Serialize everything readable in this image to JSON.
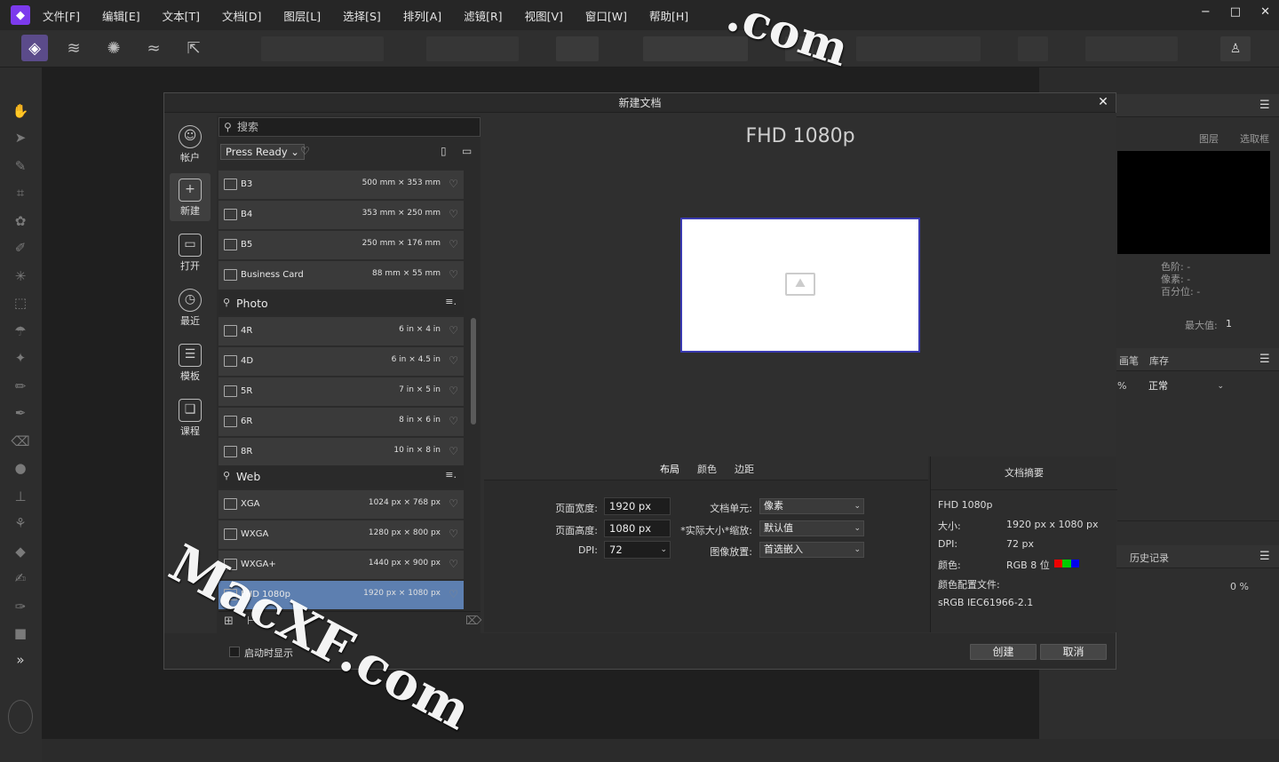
{
  "menu": {
    "items": [
      "文件[F]",
      "编辑[E]",
      "文本[T]",
      "文档[D]",
      "图层[L]",
      "选择[S]",
      "排列[A]",
      "滤镜[R]",
      "视图[V]",
      "窗口[W]",
      "帮助[H]"
    ],
    "window_controls": [
      "−",
      "□",
      "✕"
    ]
  },
  "dialog": {
    "title": "新建文档",
    "close": "✕",
    "nav": [
      {
        "label": "帐户",
        "icon": "account-icon"
      },
      {
        "label": "新建",
        "icon": "new-document-icon"
      },
      {
        "label": "打开",
        "icon": "open-folder-icon"
      },
      {
        "label": "最近",
        "icon": "recent-clock-icon"
      },
      {
        "label": "模板",
        "icon": "template-icon"
      },
      {
        "label": "课程",
        "icon": "tutorials-book-icon"
      }
    ],
    "search_placeholder": "搜索",
    "category": "Press Ready",
    "press_items": [
      {
        "name": "B3",
        "size": "500 mm × 353 mm"
      },
      {
        "name": "B4",
        "size": "353 mm × 250 mm"
      },
      {
        "name": "B5",
        "size": "250 mm × 176 mm"
      },
      {
        "name": "Business Card",
        "size": "88 mm × 55 mm"
      }
    ],
    "photo_group": "Photo",
    "photo_items": [
      {
        "name": "4R",
        "size": "6 in × 4 in"
      },
      {
        "name": "4D",
        "size": "6 in × 4.5 in"
      },
      {
        "name": "5R",
        "size": "7 in × 5 in"
      },
      {
        "name": "6R",
        "size": "8 in × 6 in"
      },
      {
        "name": "8R",
        "size": "10 in × 8 in"
      }
    ],
    "web_group": "Web",
    "web_items": [
      {
        "name": "XGA",
        "size": "1024 px × 768 px"
      },
      {
        "name": "WXGA",
        "size": "1280 px × 800 px"
      },
      {
        "name": "WXGA+",
        "size": "1440 px × 900 px"
      },
      {
        "name": "FHD 1080p",
        "size": "1920 px × 1080 px"
      }
    ],
    "preview_title": "FHD 1080p",
    "tabs": [
      "布局",
      "颜色",
      "边距"
    ],
    "layout": {
      "width_label": "页面宽度:",
      "width_value": "1920 px",
      "height_label": "页面高度:",
      "height_value": "1080 px",
      "dpi_label": "DPI:",
      "dpi_value": "72",
      "unit_label": "文档单元:",
      "unit_value": "像素",
      "scale_label": "*实际大小*缩放:",
      "scale_value": "默认值",
      "placement_label": "图像放置:",
      "placement_value": "首选嵌入"
    },
    "summary": {
      "header": "文档摘要",
      "name": "FHD 1080p",
      "size_label": "大小:",
      "size_value": "1920 px  x  1080 px",
      "dpi_label": "DPI:",
      "dpi_value": "72 px",
      "color_label": "颜色:",
      "color_value": "RGB 8 位",
      "profile_label": "颜色配置文件:",
      "profile_value": "sRGB IEC61966-2.1"
    },
    "show_on_startup": "启动时显示",
    "create": "创建",
    "cancel": "取消"
  },
  "right_panel": {
    "layers_label": "图层",
    "selection_label": "选取框",
    "info": [
      "色阶: -",
      "像素: -",
      "百分位: -"
    ],
    "max_label": "最大值:",
    "max_value": "1",
    "brush_tab": "画笔",
    "library_tab": "库存",
    "blend_percent": "%",
    "blend_mode": "正常",
    "history_label": "历史记录",
    "zoom_value": "0 %"
  },
  "watermark": [
    "MacXF.com",
    ".com"
  ],
  "colors": {
    "accent": "#7c3aed",
    "selected": "#5d7fb0",
    "page_border": "#3a3ab0"
  }
}
